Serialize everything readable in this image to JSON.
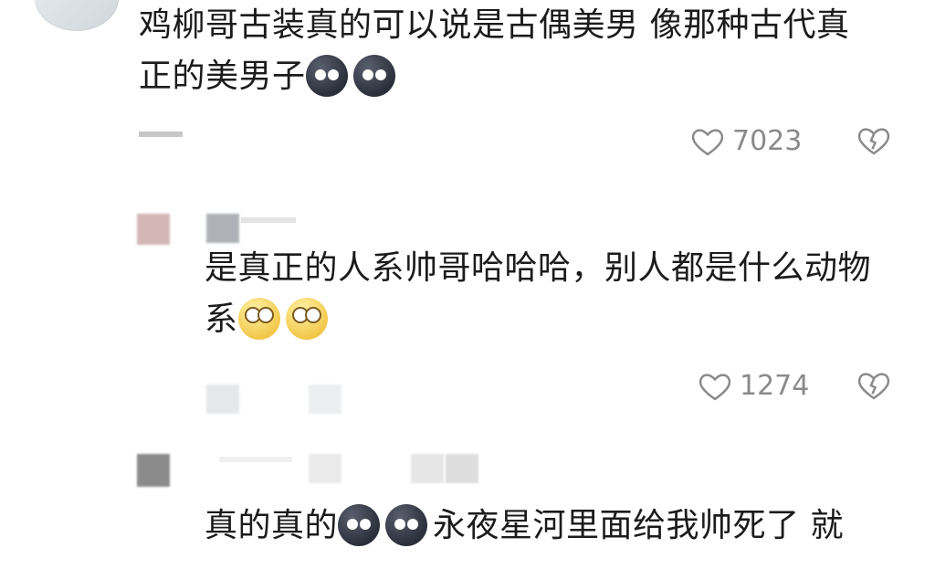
{
  "comments": [
    {
      "text_line1": "鸡柳哥古装真的可以说是古偶美男 像那种古代真",
      "text_line2": "正的美男子",
      "emojis": [
        "dark-face",
        "dark-face"
      ],
      "likes": "7023"
    },
    {
      "text_line1": "是真正的人系帅哥哈哈哈，别人都是什么动物",
      "text_line2": "系",
      "emojis": [
        "pleading-face",
        "pleading-face"
      ],
      "likes": "1274"
    },
    {
      "text_before_emojis": "真的真的",
      "emojis": [
        "dark-face",
        "dark-face"
      ],
      "text_after_emojis": "永夜星河里面给我帅死了 就"
    }
  ],
  "icons": {
    "like": "heart-outline-icon",
    "dislike": "broken-heart-icon"
  },
  "colors": {
    "text": "#1b1b1b",
    "meta": "#8a8a8a",
    "background": "#ffffff"
  }
}
